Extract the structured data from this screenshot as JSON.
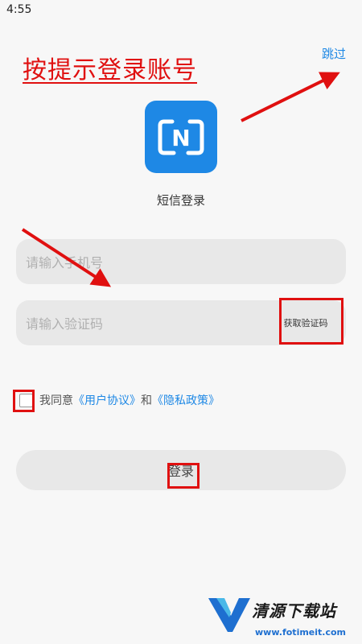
{
  "status_bar": {
    "time": "4:55"
  },
  "header": {
    "skip_label": "跳过"
  },
  "annotation": {
    "title": "按提示登录账号",
    "color": "#e01010"
  },
  "logo": {
    "icon": "n-logo-icon",
    "letter": "N",
    "color": "#1e88e5"
  },
  "page_title": "短信登录",
  "phone": {
    "placeholder": "请输入手机号",
    "value": ""
  },
  "code": {
    "placeholder": "请输入验证码",
    "value": "",
    "get_code_label": "获取验证码"
  },
  "agreement": {
    "prefix": "我同意",
    "user_agreement": "《用户协议》",
    "conjunction": "和",
    "privacy_policy": "《隐私政策》",
    "checked": false
  },
  "login_label": "登录",
  "watermark": {
    "name": "清源下载站",
    "url": "www.fotimeit.com"
  }
}
